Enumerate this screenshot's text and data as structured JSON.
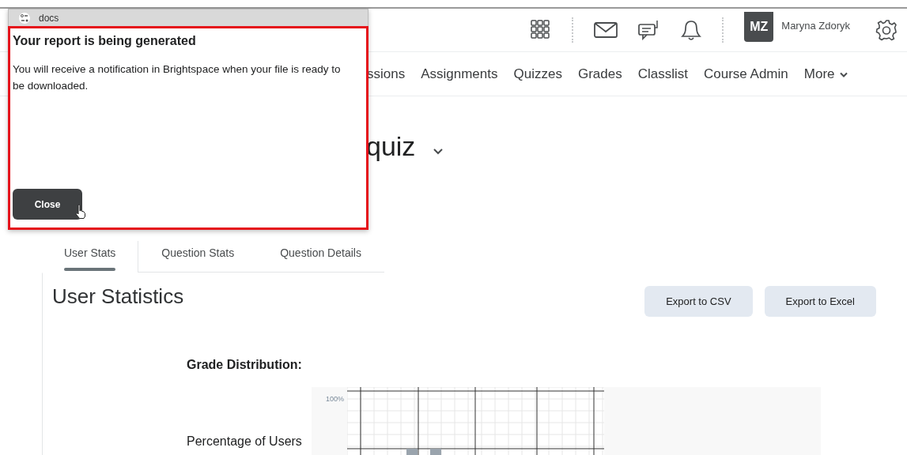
{
  "header": {
    "user_initials": "MZ",
    "user_name": "Maryna Zdoryk"
  },
  "nav": [
    {
      "label": "ssions",
      "has_menu": false
    },
    {
      "label": "Assignments",
      "has_menu": false
    },
    {
      "label": "Quizzes",
      "has_menu": false
    },
    {
      "label": "Grades",
      "has_menu": false
    },
    {
      "label": "Classlist",
      "has_menu": false
    },
    {
      "label": "Course Admin",
      "has_menu": false
    },
    {
      "label": "More",
      "has_menu": true
    }
  ],
  "page_title": "quiz",
  "tabs": [
    {
      "label": "User Stats",
      "selected": true
    },
    {
      "label": "Question Stats",
      "selected": false
    },
    {
      "label": "Question Details",
      "selected": false
    }
  ],
  "section_title": "User Statistics",
  "buttons": [
    "Export to CSV",
    "Export to Excel"
  ],
  "grade_distribution": {
    "title": "Grade Distribution:",
    "y_tick": "100%",
    "axis_label": "Percentage of Users"
  },
  "popup": {
    "window_title": "docs",
    "heading": "Your report is being generated",
    "message": "You will receive a notification in Brightspace when your file is ready to be downloaded.",
    "button": "Close"
  }
}
